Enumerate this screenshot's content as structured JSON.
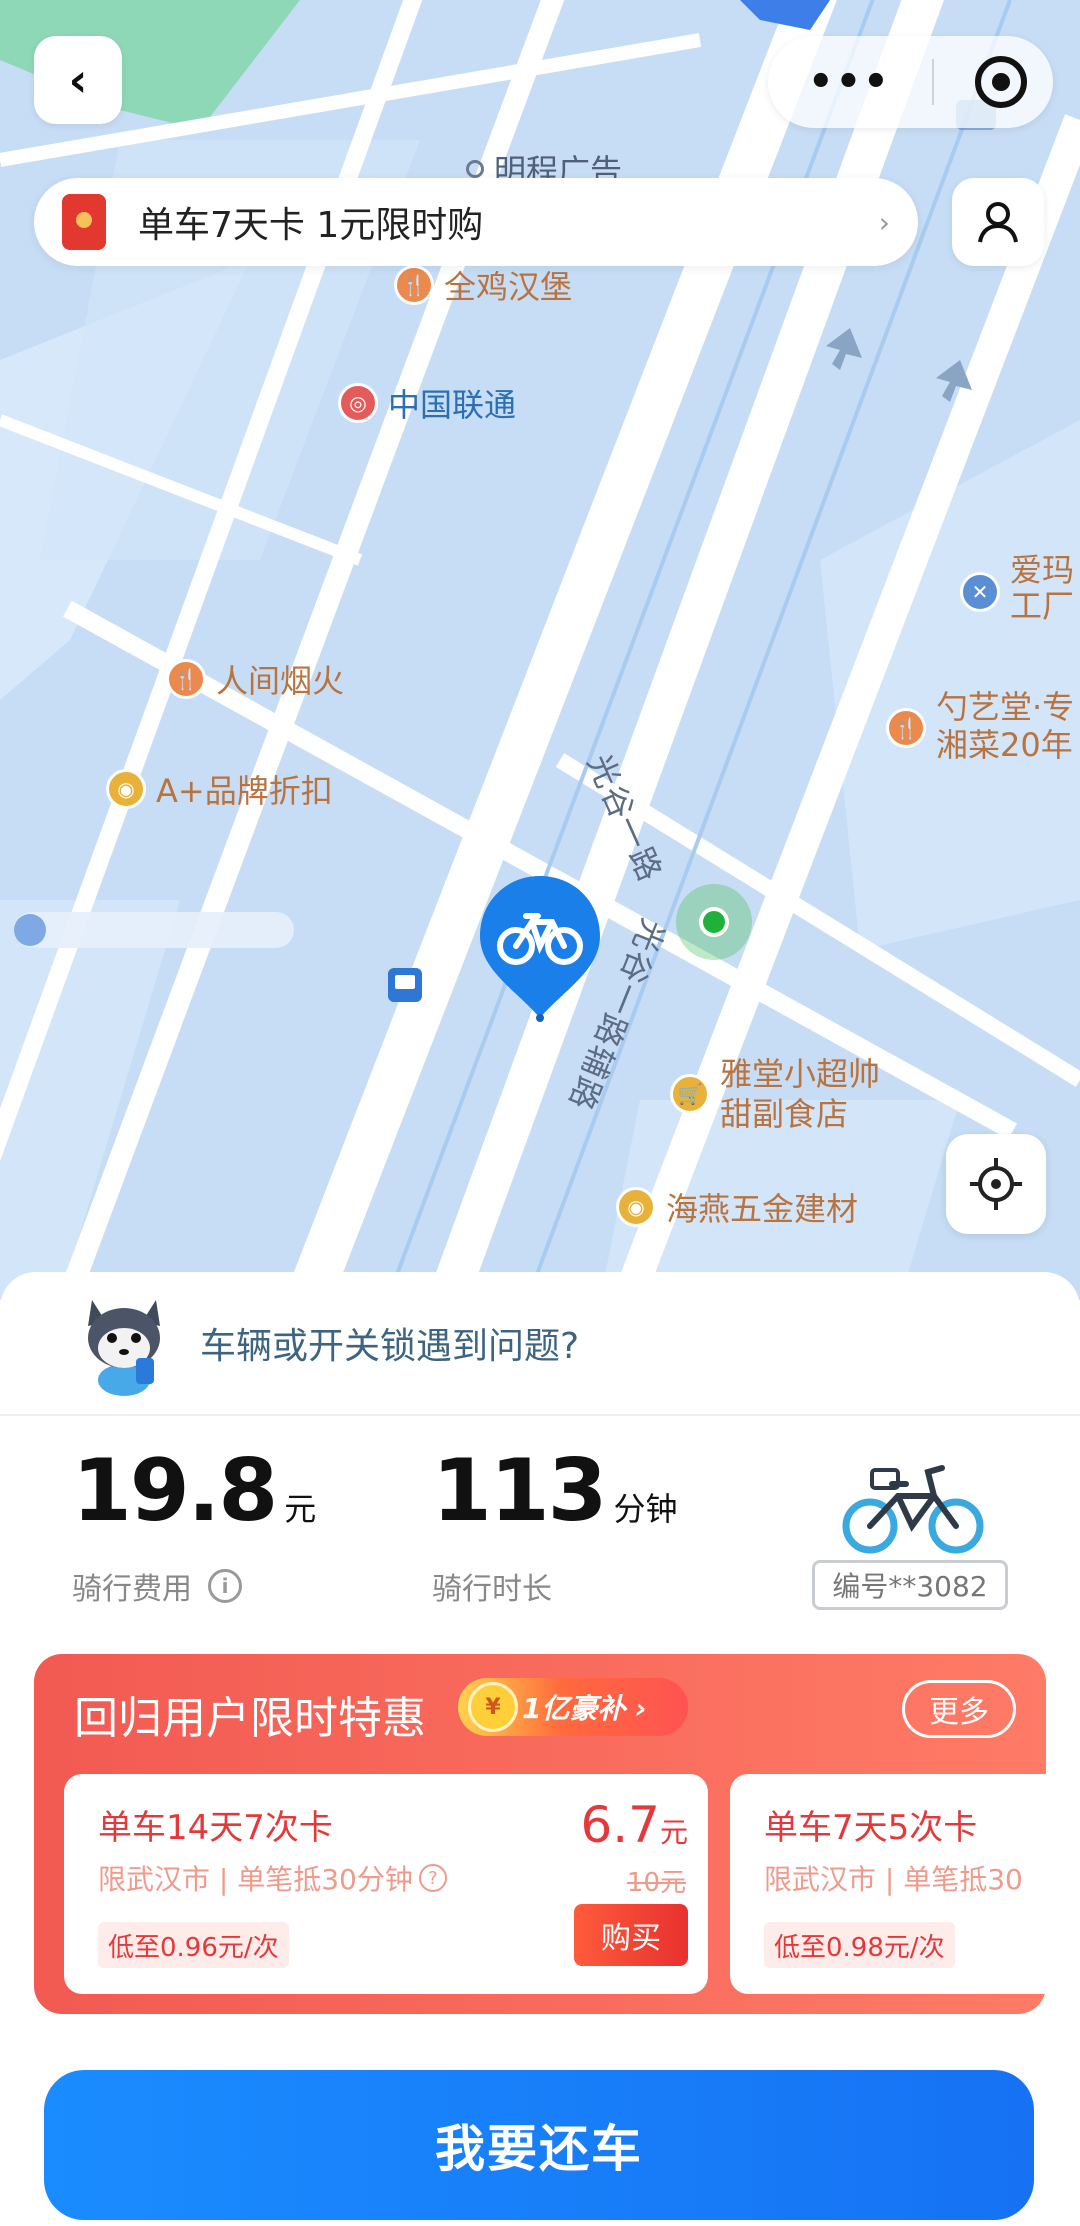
{
  "map": {
    "pois": {
      "mingcheng_ad": "明程广告",
      "chicken_burger": "全鸡汉堡",
      "china_unicom": "中国联通",
      "renjian_yanhuo": "人间烟火",
      "brand_discount": "A+品牌折扣",
      "aima_factory_1": "爱玛",
      "aima_factory_2": "工厂",
      "shaoyitang_1": "勺艺堂·专",
      "shaoyitang_2": "湘菜20年",
      "yatang_market_1": "雅堂小超帅",
      "yatang_market_2": "甜副食店",
      "haiyan_hardware": "海燕五金建材"
    },
    "roads": {
      "road_upper": "光谷一路",
      "road_lower": "光谷一路辅路"
    }
  },
  "top": {
    "back_icon": "‹",
    "more_icon": "•••"
  },
  "promo_banner": {
    "text": "单车7天卡 1元限时购",
    "chevron": "›"
  },
  "issue": {
    "text": "车辆或开关锁遇到问题?"
  },
  "ride": {
    "fee_value": "19.8",
    "fee_unit": "元",
    "fee_label": "骑行费用",
    "duration_value": "113",
    "duration_unit": "分钟",
    "duration_label": "骑行时长",
    "bike_number": "编号**3082"
  },
  "offer": {
    "title": "回归用户限时特惠",
    "tag": "1亿豪补 ›",
    "tag_coin": "¥",
    "more": "更多",
    "cards": [
      {
        "name": "单车14天7次卡",
        "sub": "限武汉市 | 单笔抵30分钟",
        "low": "低至0.96元/次",
        "price": "6.7",
        "price_unit": "元",
        "orig": "10元",
        "buy": "购买"
      },
      {
        "name": "单车7天5次卡",
        "sub": "限武汉市 | 单笔抵30",
        "low": "低至0.98元/次"
      }
    ]
  },
  "return_button": "我要还车",
  "colors": {
    "primary_blue": "#1a8cff",
    "offer_red": "#f25a52",
    "map_bg": "#c4dcf5"
  }
}
